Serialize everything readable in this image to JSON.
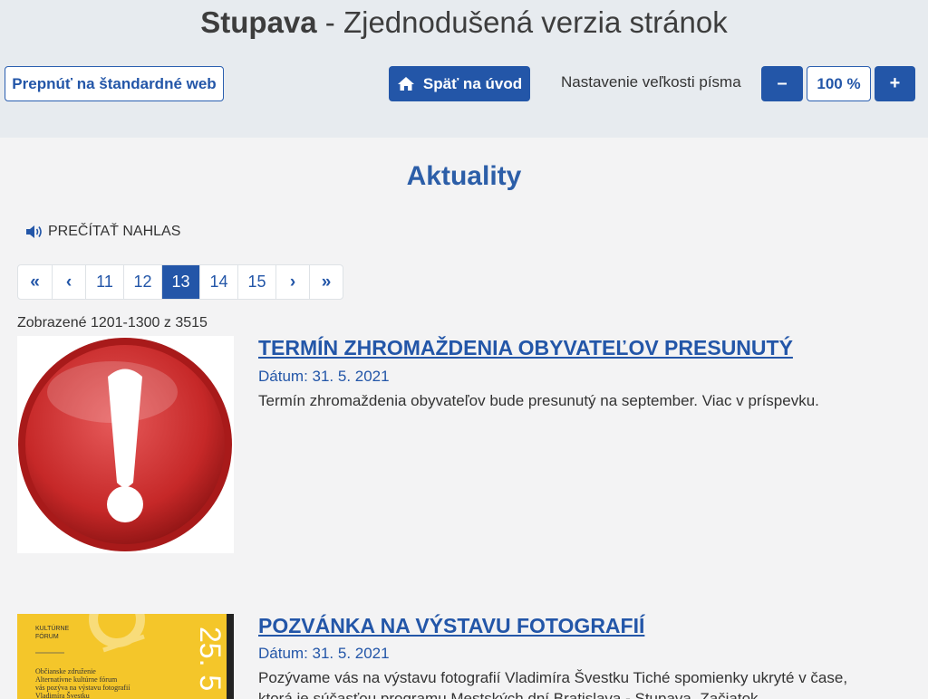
{
  "header": {
    "site_name": "Stupava",
    "subtitle": " - Zjednodušená verzia stránok",
    "switch_label": "Prepnúť na štandardné web",
    "home_label": "Späť na úvod",
    "font_size_label": "Nastavenie veľkosti písma",
    "font_decrease": "–",
    "font_value": "100 %",
    "font_increase": "+"
  },
  "page": {
    "title": "Aktuality",
    "read_aloud": "PREČÍTAŤ NAHLAS",
    "shown_count": "Zobrazené 1201-1300 z 3515"
  },
  "pagination": {
    "first": "«",
    "prev": "‹",
    "pages": [
      "11",
      "12",
      "13",
      "14",
      "15"
    ],
    "active_page": "13",
    "next": "›",
    "last": "»"
  },
  "articles": [
    {
      "title": "TERMÍN ZHROMAŽDENIA OBYVATEĽOV PRESUNUTÝ",
      "date": "Dátum: 31. 5. 2021",
      "text": "Termín zhromaždenia obyvateľov bude presunutý na september. Viac v príspevku.",
      "text2": "",
      "image_icon": "warning-exclamation-icon"
    },
    {
      "title": "POZVÁNKA NA VÝSTAVU FOTOGRAFIÍ",
      "date": "Dátum: 31. 5. 2021",
      "text": "Pozývame vás na výstavu fotografií Vladimíra Švestku Tiché spomienky ukryté v čase,",
      "text2": "ktorá je súčasťou programu Mestských dní Bratislava - Stupava. Začiatok",
      "poster": {
        "org": "KULTÚRNE FÓRUM",
        "line1": "Občianske združenie",
        "line2": "Alternatívne kultúrne fórum",
        "line3": "vás pozýva na výstavu fotografií",
        "line4": "Vladimíra Švestku",
        "date": "25. 5"
      }
    }
  ],
  "colors": {
    "accent": "#2356a8",
    "header_bg": "#e7ebef",
    "page_bg": "#f3f3f4",
    "poster_bg": "#f4c62a"
  }
}
